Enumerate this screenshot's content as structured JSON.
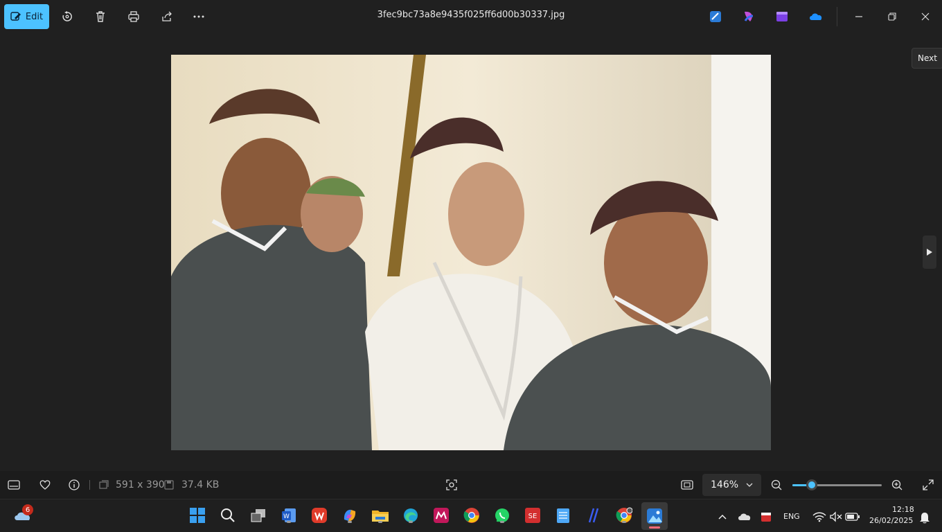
{
  "toolbar": {
    "edit_label": "Edit",
    "file_name": "3fec9bc73a8e9435f025ff6d00b30337.jpg"
  },
  "viewer": {
    "next_tooltip": "Next"
  },
  "bottom": {
    "dimensions": "591 x 390",
    "file_size": "37.4 KB",
    "zoom_value": "146%",
    "zoom_level": 0.22
  },
  "taskbar": {
    "weather_badge": "6",
    "language": "ENG",
    "time": "12:18",
    "date": "26/02/2025",
    "apps": [
      "start",
      "search",
      "task-view",
      "word",
      "wps",
      "copilot",
      "file-explorer",
      "edge",
      "app-red",
      "chrome",
      "whatsapp",
      "app-se",
      "notepad",
      "app-slash",
      "chrome-profile",
      "photos"
    ]
  },
  "colors": {
    "accent": "#4cc2ff",
    "background": "#202020"
  }
}
